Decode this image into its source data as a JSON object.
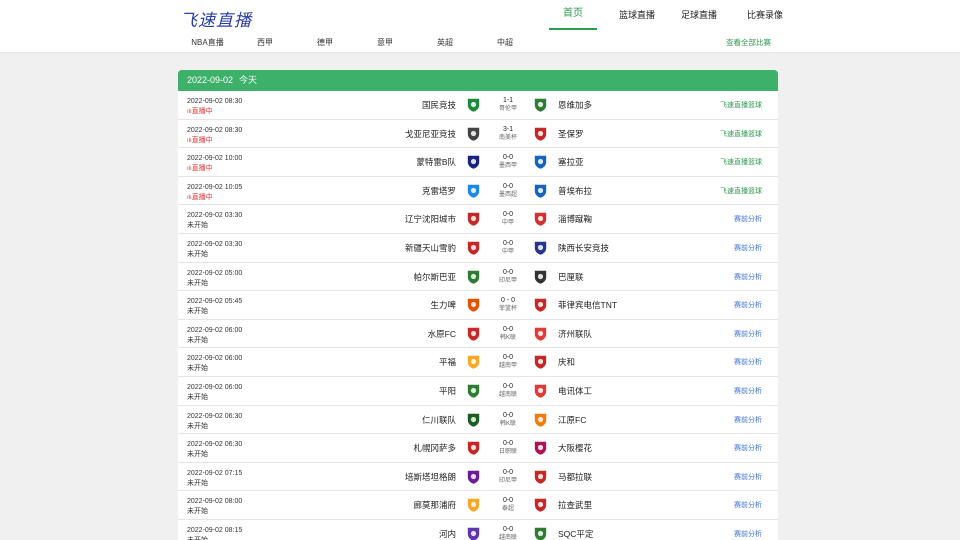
{
  "header": {
    "logo_text": "飞速直播",
    "nav": [
      {
        "label": "首页",
        "active": true
      },
      {
        "label": "篮球直播",
        "active": false
      },
      {
        "label": "足球直播",
        "active": false
      },
      {
        "label": "比赛录像",
        "active": false
      }
    ],
    "subnav": [
      "NBA直播",
      "西甲",
      "德甲",
      "意甲",
      "英超",
      "中超"
    ],
    "view_all": "查看全部比赛"
  },
  "date_bar": {
    "date": "2022-09-02",
    "day": "今天"
  },
  "colors": {
    "brand_green": "#3db06a",
    "live_red": "#e53030",
    "link_blue": "#3a6fd8"
  },
  "matches": [
    {
      "time": "2022-09-02 08:30",
      "status": "直播中",
      "live": true,
      "home": "国民竞技",
      "away": "恩维加多",
      "score": "1-1",
      "league": "哥伦甲",
      "link": "飞速直播篮球",
      "link_type": "green",
      "home_color": "#1f8a3c",
      "away_color": "#2e7d32"
    },
    {
      "time": "2022-09-02 08:30",
      "status": "直播中",
      "live": true,
      "home": "戈亚尼亚竞技",
      "away": "圣保罗",
      "score": "3-1",
      "league": "南美杯",
      "link": "飞速直播篮球",
      "link_type": "green",
      "home_color": "#444444",
      "away_color": "#c62828"
    },
    {
      "time": "2022-09-02 10:00",
      "status": "直播中",
      "live": true,
      "home": "蒙特雷B队",
      "away": "塞拉亚",
      "score": "0-0",
      "league": "墨西甲",
      "link": "飞速直播篮球",
      "link_type": "green",
      "home_color": "#1a237e",
      "away_color": "#1565c0"
    },
    {
      "time": "2022-09-02 10:05",
      "status": "直播中",
      "live": true,
      "home": "克雷塔罗",
      "away": "普埃布拉",
      "score": "0-0",
      "league": "墨西超",
      "link": "飞速直播篮球",
      "link_type": "green",
      "home_color": "#1e88e5",
      "away_color": "#1565c0"
    },
    {
      "time": "2022-09-02 03:30",
      "status": "未开始",
      "live": false,
      "home": "辽宁沈阳城市",
      "away": "淄博蹴鞠",
      "score": "0-0",
      "league": "中甲",
      "link": "赛前分析",
      "link_type": "blue",
      "home_color": "#c62828",
      "away_color": "#d32f2f"
    },
    {
      "time": "2022-09-02 03:30",
      "status": "未开始",
      "live": false,
      "home": "新疆天山雪豹",
      "away": "陕西长安竞技",
      "score": "0-0",
      "league": "中甲",
      "link": "赛前分析",
      "link_type": "blue",
      "home_color": "#c62828",
      "away_color": "#283593"
    },
    {
      "time": "2022-09-02 05:00",
      "status": "未开始",
      "live": false,
      "home": "帕尔斯巴亚",
      "away": "巴厘联",
      "score": "0-0",
      "league": "印尼甲",
      "link": "赛前分析",
      "link_type": "blue",
      "home_color": "#2e7d32",
      "away_color": "#333333"
    },
    {
      "time": "2022-09-02 05:45",
      "status": "未开始",
      "live": false,
      "home": "生力啤",
      "away": "菲律宾电信TNT",
      "score": "0 - 0",
      "league": "菲篮杯",
      "link": "赛前分析",
      "link_type": "blue",
      "home_color": "#e65100",
      "away_color": "#c62828"
    },
    {
      "time": "2022-09-02 06:00",
      "status": "未开始",
      "live": false,
      "home": "水原FC",
      "away": "济州联队",
      "score": "0-0",
      "league": "韩K联",
      "link": "赛前分析",
      "link_type": "blue",
      "home_color": "#c62828",
      "away_color": "#e53935"
    },
    {
      "time": "2022-09-02 06:00",
      "status": "未开始",
      "live": false,
      "home": "平福",
      "away": "庆和",
      "score": "0-0",
      "league": "越南甲",
      "link": "赛前分析",
      "link_type": "blue",
      "home_color": "#f9a825",
      "away_color": "#c62828"
    },
    {
      "time": "2022-09-02 06:00",
      "status": "未开始",
      "live": false,
      "home": "平阳",
      "away": "电讯体工",
      "score": "0-0",
      "league": "越南联",
      "link": "赛前分析",
      "link_type": "blue",
      "home_color": "#2e7d32",
      "away_color": "#e53935"
    },
    {
      "time": "2022-09-02 06:30",
      "status": "未开始",
      "live": false,
      "home": "仁川联队",
      "away": "江原FC",
      "score": "0-0",
      "league": "韩K联",
      "link": "赛前分析",
      "link_type": "blue",
      "home_color": "#1b5e20",
      "away_color": "#f57c00"
    },
    {
      "time": "2022-09-02 06:30",
      "status": "未开始",
      "live": false,
      "home": "札幌冈萨多",
      "away": "大阪樱花",
      "score": "0-0",
      "league": "日职联",
      "link": "赛前分析",
      "link_type": "blue",
      "home_color": "#c62828",
      "away_color": "#ad1457"
    },
    {
      "time": "2022-09-02 07:15",
      "status": "未开始",
      "live": false,
      "home": "培斯塔坦格朗",
      "away": "马都拉联",
      "score": "0-0",
      "league": "印尼甲",
      "link": "赛前分析",
      "link_type": "blue",
      "home_color": "#6a1b9a",
      "away_color": "#c62828"
    },
    {
      "time": "2022-09-02 08:00",
      "status": "未开始",
      "live": false,
      "home": "廊莫那浦府",
      "away": "拉查武里",
      "score": "0-0",
      "league": "泰超",
      "link": "赛前分析",
      "link_type": "blue",
      "home_color": "#f9a825",
      "away_color": "#c62828"
    },
    {
      "time": "2022-09-02 08:15",
      "status": "未开始",
      "live": false,
      "home": "河内",
      "away": "SQC平定",
      "score": "0-0",
      "league": "越南联",
      "link": "赛前分析",
      "link_type": "blue",
      "home_color": "#5e35b1",
      "away_color": "#2e7d32"
    }
  ]
}
